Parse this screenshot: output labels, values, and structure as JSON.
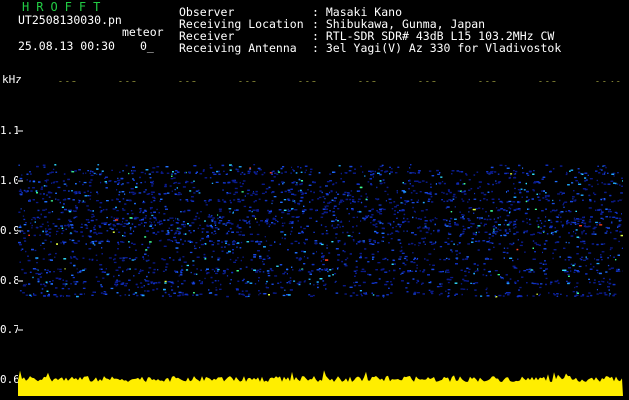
{
  "header": {
    "brand": "HROFFT",
    "filename": "UT2508130030.pn",
    "mode": "meteor",
    "datetime": "25.08.13 00:30",
    "counter": "0_",
    "fields": [
      {
        "label": "Observer",
        "value": ": Masaki Kano"
      },
      {
        "label": "Receiving Location",
        "value": ": Shibukawa, Gunma, Japan"
      },
      {
        "label": "Receiver",
        "value": ": RTL-SDR SDR# 43dB L15 103.2MHz CW"
      },
      {
        "label": "Receiving Antenna",
        "value": ": 3el Yagi(V) Az 330 for Vladivostok"
      }
    ]
  },
  "axis": {
    "unit": "kHz",
    "y_ticks": [
      "1.1",
      "1.0",
      "0.9",
      "0.8",
      "0.7",
      "0.6"
    ],
    "x_ticks": [
      "003",
      "003",
      "003",
      "003",
      "003",
      "003",
      "003",
      "003",
      "003",
      "0040"
    ]
  },
  "colors": {
    "background": "#000000",
    "brand": "#22cc44",
    "tick_label": "#ffff66",
    "bottom_band": "#ffee00"
  }
}
